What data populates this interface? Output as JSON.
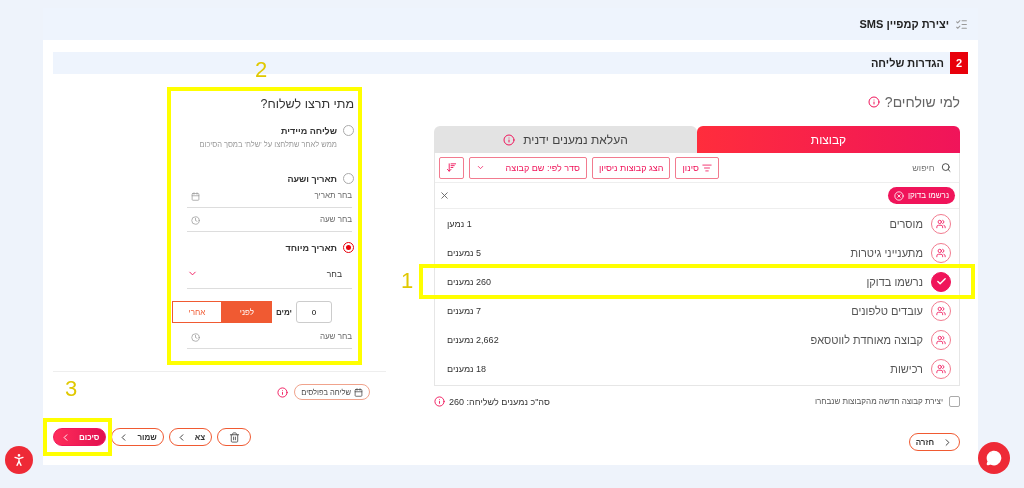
{
  "header": {
    "title": "יצירת קמפיין SMS"
  },
  "section": {
    "step": "2",
    "title": "הגדרות שליחה"
  },
  "recipients": {
    "title": "למי שולחים?",
    "tabs": [
      {
        "label": "קבוצות",
        "selected": true,
        "info": false
      },
      {
        "label": "העלאת נמענים ידנית",
        "selected": false,
        "info": true
      }
    ],
    "search": {
      "placeholder": "חיפוש"
    },
    "filter_button": "סינון",
    "test_groups_button": "הצג קבוצות ניסיון",
    "sort_select": "סדר לפי: שם קבוצה",
    "chips": [
      {
        "label": "נרשמו בדוקן"
      }
    ],
    "groups": [
      {
        "name": "מוסרים",
        "count": "1 נמען",
        "selected": false
      },
      {
        "name": "מתענייני גיטרות",
        "count": "5 נמענים",
        "selected": false
      },
      {
        "name": "נרשמו בדוקן",
        "count": "260 נמענים",
        "selected": true,
        "highlight": "1"
      },
      {
        "name": "עובדים טלפונים",
        "count": "7 נמענים",
        "selected": false
      },
      {
        "name": "קבוצה מאוחדת לווטסאפ",
        "count": "2,662 נמענים",
        "selected": false
      },
      {
        "name": "רכישות",
        "count": "18 נמענים",
        "selected": false
      }
    ],
    "create_group": {
      "label": "יצירת קבוצה חדשה מהקבוצות שנבחרו",
      "checked": false
    },
    "total": "סה\"כ נמענים לשליחה: 260",
    "back_button": "חזרה"
  },
  "schedule": {
    "title": "מתי תרצו לשלוח?",
    "highlight": "2",
    "options": [
      {
        "kind": "immediate",
        "label": "שליחה מיידית",
        "selected": false,
        "hint": "ממש לאחר שתלחצו על 'שלח' במסך הסיכום"
      },
      {
        "kind": "datetime",
        "label": "תאריך ושעה",
        "selected": false,
        "date_placeholder": "בחר תאריך",
        "time_placeholder": "בחר שעה"
      },
      {
        "kind": "special",
        "label": "תאריך מיוחד",
        "selected": true,
        "select_placeholder": "בחר",
        "days": "0",
        "days_label": "ימים",
        "time_placeholder": "בחר שעה",
        "offsets": [
          {
            "label": "לפני",
            "selected": true
          },
          {
            "label": "אחרי",
            "selected": false
          }
        ]
      }
    ]
  },
  "pulse_button": "שליחה בפולסים",
  "actions": [
    {
      "kind": "delete"
    },
    {
      "kind": "outline",
      "label": "צא"
    },
    {
      "kind": "outline",
      "label": "שמור"
    },
    {
      "kind": "primary",
      "label": "סיכום",
      "highlight": "3"
    }
  ]
}
